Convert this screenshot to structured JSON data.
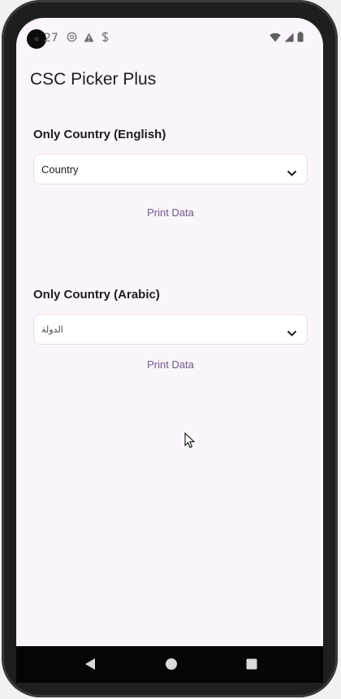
{
  "status_bar": {
    "time": "27"
  },
  "app": {
    "title": "CSC Picker Plus"
  },
  "sections": [
    {
      "label": "Only Country (English)",
      "dropdown_value": "Country",
      "button_label": "Print Data"
    },
    {
      "label": "Only Country (Arabic)",
      "dropdown_value": "الدولة",
      "button_label": "Print Data"
    }
  ],
  "colors": {
    "background": "#fdf5fc",
    "text": "#1d1b20",
    "accent": "#6b5a85"
  }
}
